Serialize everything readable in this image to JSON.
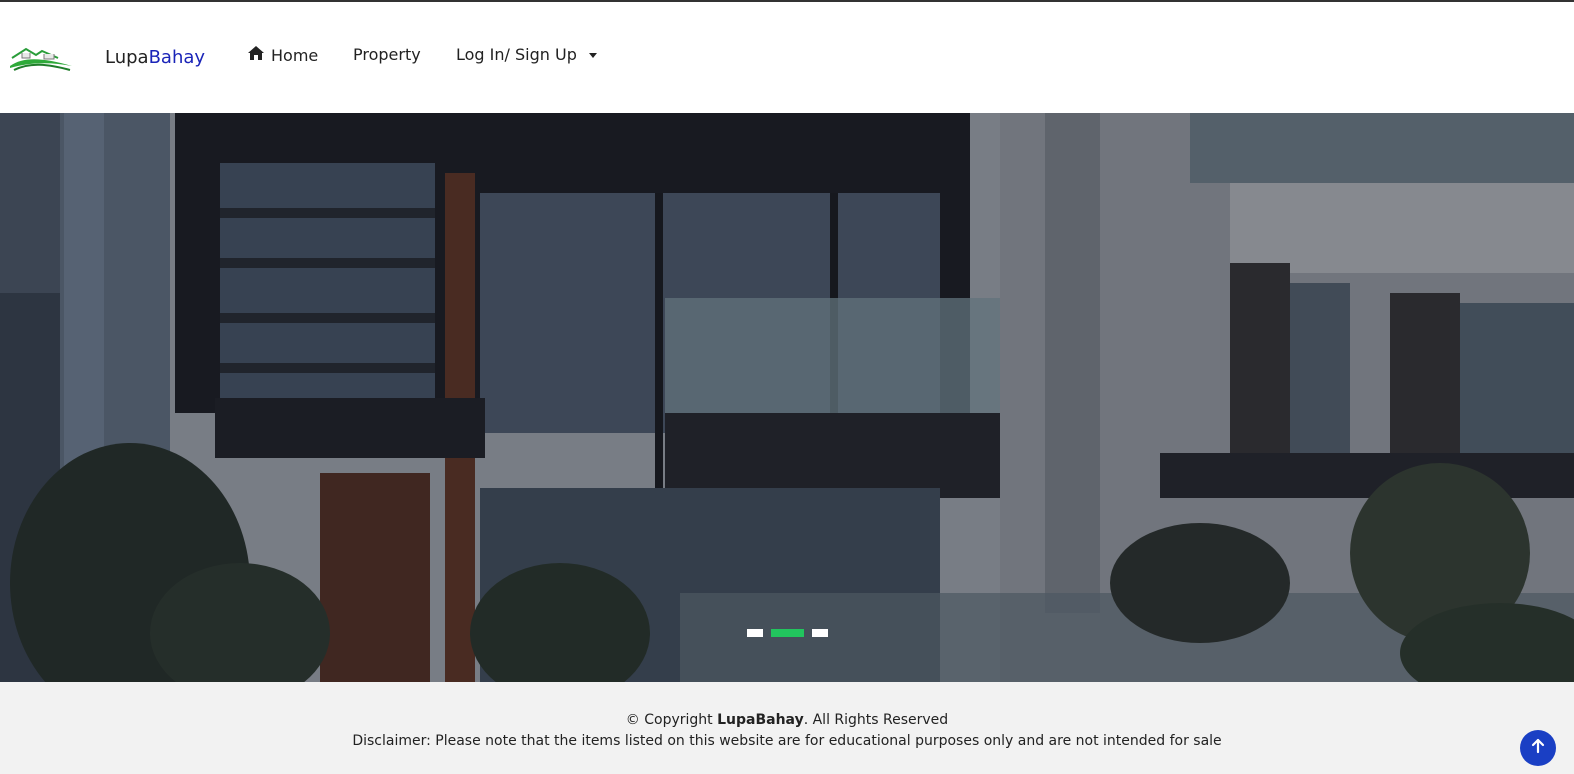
{
  "brand": {
    "part1": "Lupa",
    "part2": "Bahay",
    "color_part2": "#1a24b8"
  },
  "nav": {
    "home_label": "Home",
    "property_label": "Property",
    "login_label": "Log In/ Sign Up"
  },
  "hero": {
    "slides_total": 3,
    "active_slide": 2
  },
  "footer": {
    "copyright_prefix": "© Copyright ",
    "copyright_brand": "LupaBahay",
    "copyright_suffix": ". All Rights Reserved",
    "disclaimer": "Disclaimer: Please note that the items listed on this website are for educational purposes only and are not intended for sale"
  },
  "colors": {
    "accent_green": "#22c55e",
    "scroll_top_blue": "#1a3fc4",
    "footer_bg": "#f2f2f2"
  },
  "icons": {
    "home": "home-icon",
    "scroll_top": "arrow-up-icon",
    "logo": "house-logo-icon"
  }
}
